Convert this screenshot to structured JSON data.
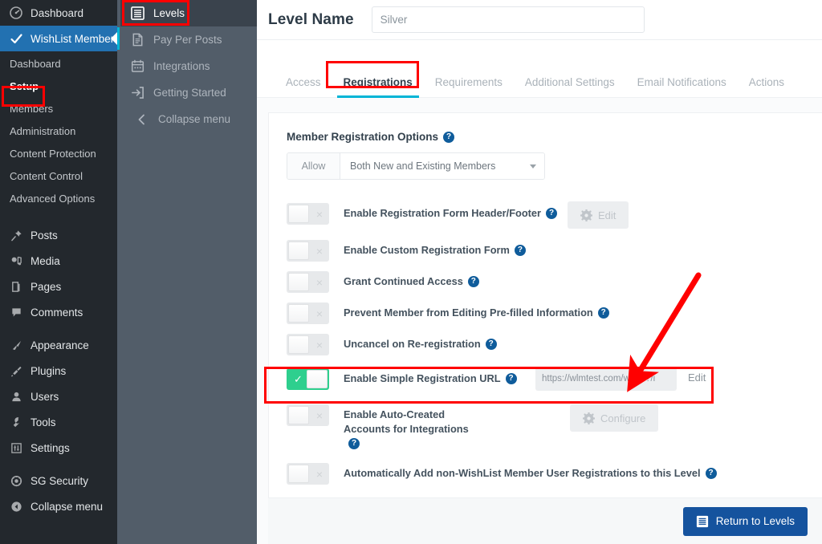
{
  "wp_sidebar": {
    "items": [
      {
        "label": "Dashboard",
        "icon": "dashboard-icon",
        "active": false
      },
      {
        "label": "WishList Member",
        "icon": "check-icon",
        "active": true
      }
    ],
    "submenu": [
      {
        "label": "Dashboard",
        "selected": false
      },
      {
        "label": "Setup",
        "selected": true
      },
      {
        "label": "Members",
        "selected": false
      },
      {
        "label": "Administration",
        "selected": false
      },
      {
        "label": "Content Protection",
        "selected": false
      },
      {
        "label": "Content Control",
        "selected": false
      },
      {
        "label": "Advanced Options",
        "selected": false
      }
    ],
    "core_group_1": [
      {
        "label": "Posts",
        "icon": "pin-icon"
      },
      {
        "label": "Media",
        "icon": "media-icon"
      },
      {
        "label": "Pages",
        "icon": "pages-icon"
      },
      {
        "label": "Comments",
        "icon": "comment-icon"
      }
    ],
    "core_group_2": [
      {
        "label": "Appearance",
        "icon": "brush-icon"
      },
      {
        "label": "Plugins",
        "icon": "plug-icon"
      },
      {
        "label": "Users",
        "icon": "user-icon"
      },
      {
        "label": "Tools",
        "icon": "wrench-icon"
      },
      {
        "label": "Settings",
        "icon": "sliders-icon"
      }
    ],
    "core_group_3": [
      {
        "label": "SG Security",
        "icon": "shield-gear-icon"
      },
      {
        "label": "Collapse menu",
        "icon": "collapse-circle-icon"
      }
    ]
  },
  "plugin_panel": {
    "items": [
      {
        "label": "Levels",
        "icon": "levels-icon",
        "active": true
      },
      {
        "label": "Pay Per Posts",
        "icon": "document-icon",
        "active": false
      },
      {
        "label": "Integrations",
        "icon": "calendar-icon",
        "active": false
      },
      {
        "label": "Getting Started",
        "icon": "arrow-in-box-icon",
        "active": false
      },
      {
        "label": "Collapse menu",
        "icon": "chevron-left-icon",
        "active": false
      }
    ]
  },
  "header": {
    "level_name_label": "Level Name",
    "level_name_value": "Silver",
    "level_name_placeholder": "Level Name"
  },
  "tabs": [
    {
      "label": "Access",
      "active": false
    },
    {
      "label": "Registrations",
      "active": true
    },
    {
      "label": "Requirements",
      "active": false
    },
    {
      "label": "Additional Settings",
      "active": false
    },
    {
      "label": "Email Notifications",
      "active": false
    },
    {
      "label": "Actions",
      "active": false
    }
  ],
  "registrations": {
    "section_title": "Member Registration Options",
    "allow_label": "Allow",
    "allow_value": "Both New and Existing Members",
    "help_glyph": "?",
    "options": [
      {
        "label": "Enable Registration Form Header/Footer",
        "enabled": false,
        "toggle_mark": "×",
        "action_label": "Edit",
        "action_type": "gear-button",
        "action_disabled": true
      },
      {
        "label": "Enable Custom Registration Form",
        "enabled": false,
        "toggle_mark": "×",
        "action_label": "",
        "action_type": "none"
      },
      {
        "label": "Grant Continued Access",
        "enabled": false,
        "toggle_mark": "×",
        "action_label": "",
        "action_type": "none"
      },
      {
        "label": "Prevent Member from Editing Pre-filled Information",
        "enabled": false,
        "toggle_mark": "×",
        "action_label": "",
        "action_type": "none"
      },
      {
        "label": "Uncancel on Re-registration",
        "enabled": false,
        "toggle_mark": "×",
        "action_label": "",
        "action_type": "none"
      },
      {
        "label": "Enable Simple Registration URL",
        "enabled": true,
        "toggle_mark": "✓",
        "url_value": "https://wlmtest.com/wray/?/i",
        "action_label": "Edit",
        "action_type": "text-link",
        "highlighted": true
      },
      {
        "label": "Enable Auto-Created Accounts for Integrations",
        "enabled": false,
        "toggle_mark": "×",
        "action_label": "Configure",
        "action_type": "gear-button",
        "action_disabled": true
      },
      {
        "label": "Automatically Add non-WishList Member User Registrations to this Level",
        "enabled": false,
        "toggle_mark": "×",
        "action_label": "",
        "action_type": "none"
      }
    ]
  },
  "footer": {
    "return_label": "Return to Levels"
  },
  "colors": {
    "wp_sidebar_bg": "#23282d",
    "wp_active_blue": "#2271b1",
    "plugin_panel_bg": "#525d69",
    "plugin_active_bg": "#3a434d",
    "tab_underline": "#00b5d6",
    "toggle_on_green": "#2ecf8e",
    "annotation_red": "#ff0000",
    "primary_button": "#15539e",
    "help_badge": "#0f5c9b"
  }
}
